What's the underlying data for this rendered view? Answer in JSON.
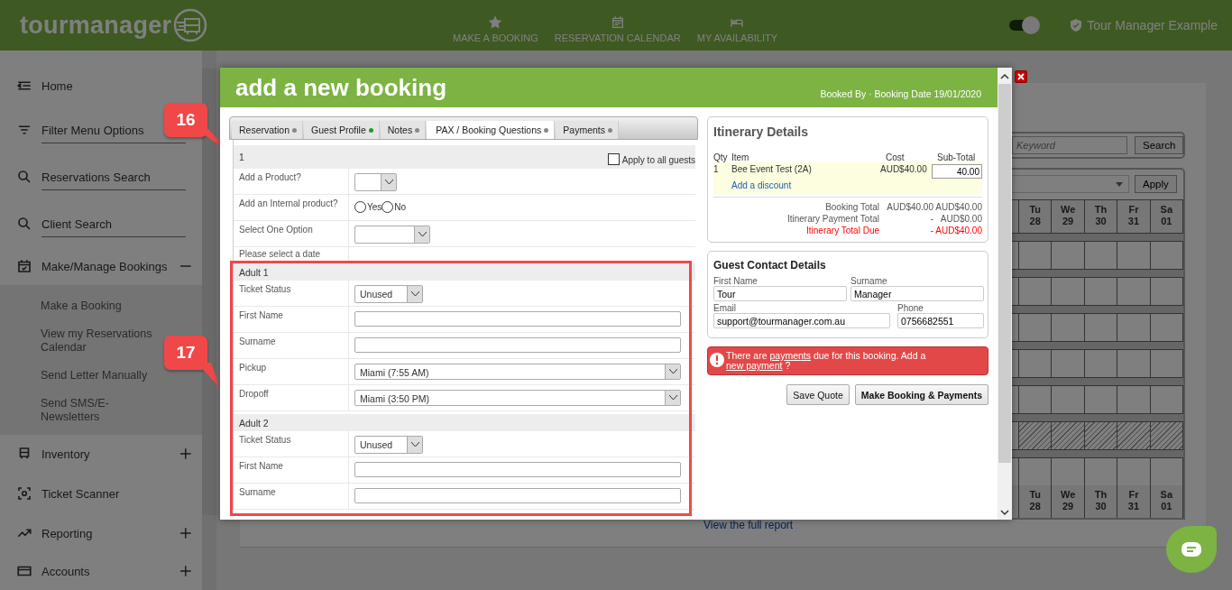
{
  "header": {
    "logo": "tourmanager",
    "nav": [
      "MAKE A BOOKING",
      "RESERVATION CALENDAR",
      "MY AVAILABILITY"
    ],
    "toggle": {
      "on": true
    },
    "user": "Tour Manager Example"
  },
  "sidebar": {
    "items": [
      {
        "label": "Home",
        "kind": "nav"
      },
      {
        "label": "Filter Menu Options",
        "kind": "tool"
      },
      {
        "label": "Reservations Search",
        "kind": "tool"
      },
      {
        "label": "Client Search",
        "kind": "tool"
      },
      {
        "label": "Make/Manage Bookings",
        "kind": "group",
        "expanded": true,
        "children": [
          {
            "label": "Make a Booking"
          },
          {
            "label": "View my Reservations Calendar"
          },
          {
            "label": "Send Letter Manually"
          },
          {
            "label": "Send SMS/E-Newsletters"
          }
        ]
      },
      {
        "label": "Inventory",
        "kind": "group",
        "expanded": false
      },
      {
        "label": "Ticket Scanner",
        "kind": "nav"
      },
      {
        "label": "Reporting",
        "kind": "group",
        "expanded": false
      },
      {
        "label": "Accounts",
        "kind": "group",
        "expanded": false
      }
    ]
  },
  "background": {
    "search_placeholder": "Keyword",
    "search_button": "Search",
    "apply_button": "Apply",
    "top_days": [
      {
        "dow": "Tu",
        "date": "28"
      },
      {
        "dow": "We",
        "date": "29"
      },
      {
        "dow": "Th",
        "date": "30"
      },
      {
        "dow": "Fr",
        "date": "31"
      },
      {
        "dow": "Sa",
        "date": "01"
      }
    ],
    "bottom_days": [
      {
        "dow": "Tu",
        "date": "28"
      },
      {
        "dow": "We",
        "date": "29"
      },
      {
        "dow": "Th",
        "date": "30"
      },
      {
        "dow": "Fr",
        "date": "31"
      },
      {
        "dow": "Sa",
        "date": "01"
      }
    ],
    "report_link": "View the full report"
  },
  "modal": {
    "title": "add a new booking",
    "meta": "Booked By · Booking Date 19/01/2020",
    "tabs": [
      {
        "label": "Reservation",
        "selected": false,
        "color": "#888888"
      },
      {
        "label": "Guest Profile",
        "selected": false,
        "color": "#1e9e1e"
      },
      {
        "label": "Notes",
        "selected": false,
        "color": "#888888"
      },
      {
        "label": "PAX / Booking Questions",
        "selected": true,
        "color": "#888888"
      },
      {
        "label": "Payments",
        "selected": false,
        "color": "#888888"
      }
    ],
    "section": "1",
    "apply_all": {
      "label": "Apply to all guests",
      "checked": false
    },
    "questions": [
      {
        "label": "Add a Product?",
        "kind": "tiny_select"
      },
      {
        "label": "Add an Internal product?",
        "kind": "radio",
        "options": [
          {
            "label": "Yes",
            "selected": false
          },
          {
            "label": "No",
            "selected": false
          }
        ]
      },
      {
        "label": "Select One Option",
        "kind": "select"
      },
      {
        "label": "Please select a date",
        "kind": "note"
      }
    ],
    "guests": [
      {
        "title": "Adult 1",
        "fields": [
          {
            "label": "Ticket Status",
            "kind": "select",
            "value": "Unused"
          },
          {
            "label": "First Name",
            "kind": "text"
          },
          {
            "label": "Surname",
            "kind": "text"
          },
          {
            "label": "Pickup",
            "kind": "wide_select",
            "value": "Miami (7:55 AM)"
          },
          {
            "label": "Dropoff",
            "kind": "wide_select",
            "value": "Miami (3:50 PM)"
          }
        ]
      },
      {
        "title": "Adult 2",
        "fields": [
          {
            "label": "Ticket Status",
            "kind": "select",
            "value": "Unused"
          },
          {
            "label": "First Name",
            "kind": "text"
          },
          {
            "label": "Surname",
            "kind": "text"
          }
        ]
      }
    ],
    "itinerary": {
      "title": "Itinerary Details",
      "columns": [
        "Qty",
        "Item",
        "Cost",
        "Sub-Total"
      ],
      "items": [
        {
          "qty": "1",
          "item": "Bee Event Test (2A)",
          "cost": "AUD$40.00",
          "subtotal": "40.00",
          "link": "Add a discount"
        }
      ],
      "totals": [
        {
          "label": "Booking Total",
          "a": "AUD$40.00",
          "b": "AUD$40.00",
          "kind": "normal"
        },
        {
          "label": "Itinerary Payment Total",
          "a": "-",
          "b": "AUD$0.00",
          "kind": "normal"
        },
        {
          "label": "Itinerary Total Due",
          "a": "-",
          "b": "AUD$40.00",
          "kind": "due"
        }
      ]
    },
    "contact": {
      "title": "Guest Contact Details",
      "fields": [
        {
          "label": "First Name",
          "value": "Tour"
        },
        {
          "label": "Surname",
          "value": "Manager"
        },
        {
          "label": "Email",
          "value": "support@tourmanager.com.au"
        },
        {
          "label": "Phone",
          "value": "0756682551"
        }
      ]
    },
    "alert": [
      {
        "kind": "text",
        "text": "There are"
      },
      {
        "kind": "link",
        "text": "payments"
      },
      {
        "kind": "text",
        "text": "due for this booking. Add a"
      },
      {
        "kind": "link",
        "text": "new payment"
      },
      {
        "kind": "text",
        "text": "?"
      }
    ],
    "buttons": [
      "Save Quote",
      "Make Booking & Payments"
    ]
  },
  "callouts": [
    "16",
    "17"
  ]
}
